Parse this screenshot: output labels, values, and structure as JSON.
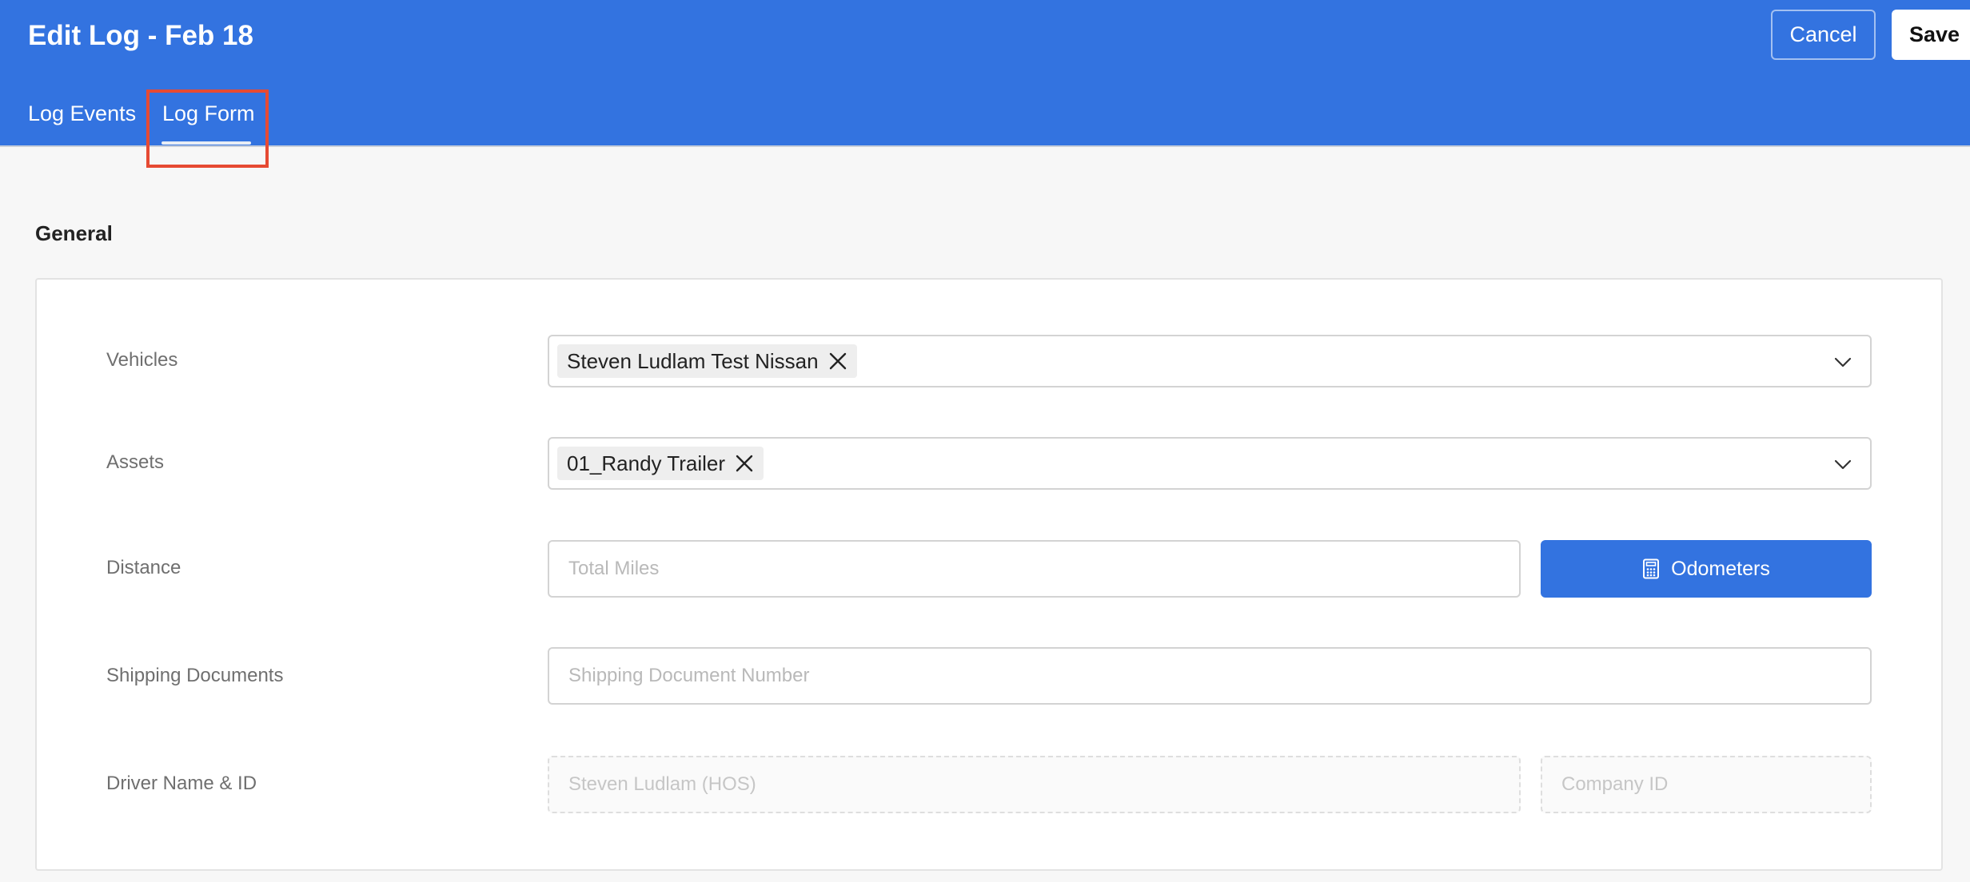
{
  "header": {
    "title": "Edit Log - Feb 18",
    "cancel_label": "Cancel",
    "save_label": "Save",
    "tabs": [
      {
        "label": "Log Events",
        "active": false
      },
      {
        "label": "Log Form",
        "active": true
      }
    ],
    "bg_color": "#3373e0"
  },
  "section": {
    "title": "General"
  },
  "form": {
    "vehicles": {
      "label": "Vehicles",
      "selected": [
        "Steven Ludlam Test Nissan"
      ]
    },
    "assets": {
      "label": "Assets",
      "selected": [
        "01_Randy Trailer"
      ]
    },
    "distance": {
      "label": "Distance",
      "value": "",
      "placeholder": "Total Miles",
      "button_label": "Odometers",
      "button_icon": "calculator-icon"
    },
    "shipping": {
      "label": "Shipping Documents",
      "value": "",
      "placeholder": "Shipping Document Number"
    },
    "driver": {
      "label": "Driver Name & ID",
      "name_placeholder": "Steven Ludlam (HOS)",
      "company_placeholder": "Company ID"
    }
  },
  "annotation_color": "#e64a33"
}
